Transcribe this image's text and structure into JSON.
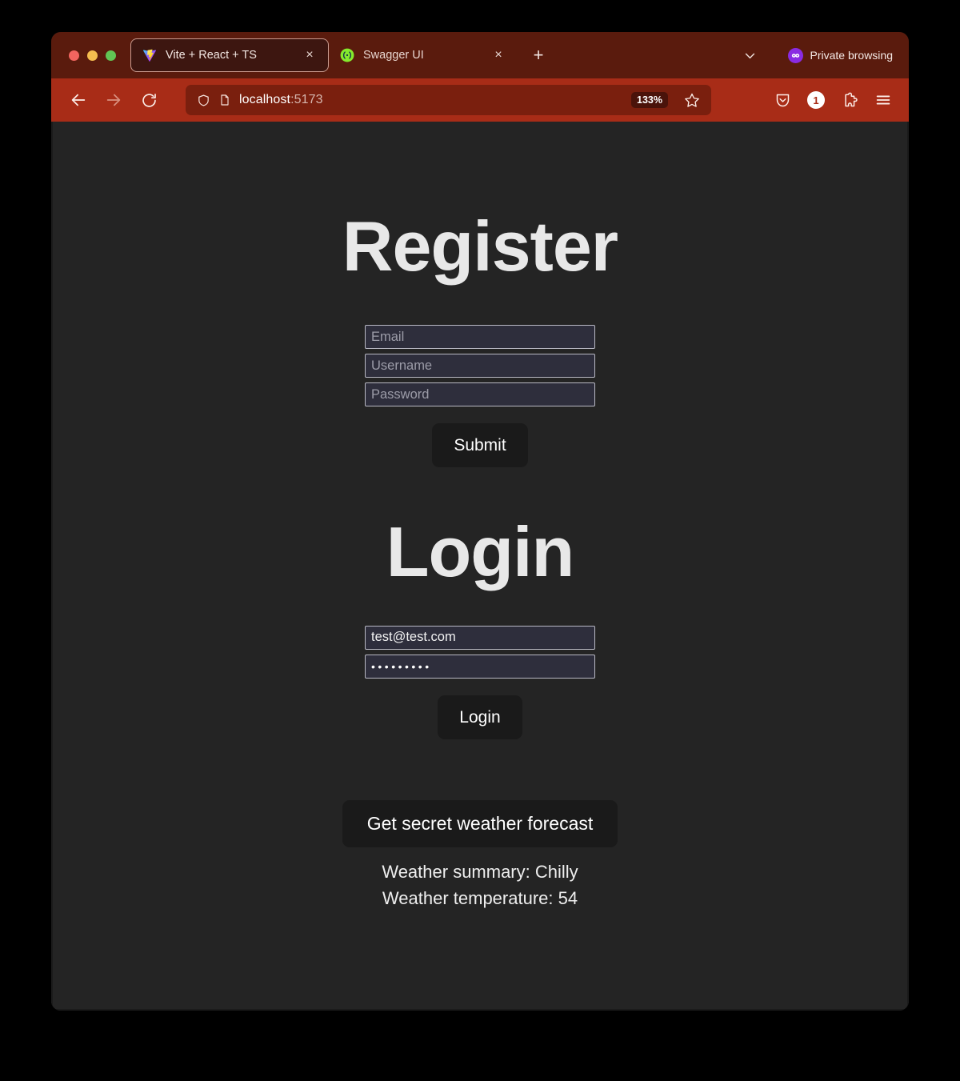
{
  "browser": {
    "window_controls": [
      "close",
      "minimize",
      "maximize"
    ],
    "tabs": [
      {
        "title": "Vite + React + TS",
        "favicon": "vite-icon",
        "active": true,
        "close_label": "×"
      },
      {
        "title": "Swagger UI",
        "favicon": "swagger-icon",
        "active": false,
        "close_label": "×"
      }
    ],
    "new_tab_label": "+",
    "list_all_tabs_icon": "chevron-down-icon",
    "private_browsing_label": "Private browsing",
    "private_browsing_icon": "mask-icon",
    "nav": {
      "back_icon": "arrow-left-icon",
      "forward_icon": "arrow-right-icon",
      "reload_icon": "reload-icon",
      "shield_icon": "shield-icon",
      "page_icon": "page-icon",
      "url_host": "localhost",
      "url_port": ":5173",
      "zoom_level": "133%",
      "bookmark_icon": "star-icon",
      "pocket_icon": "pocket-icon",
      "notification_count": "1",
      "extensions_icon": "puzzle-icon",
      "menu_icon": "hamburger-menu-icon"
    },
    "colors": {
      "tabbar_bg": "#5a1b0d",
      "navbar_bg": "#a82c17",
      "active_tab_bg": "#3d1610",
      "urlbar_bg": "#7a1f0e",
      "private_accent": "#8a2be2"
    }
  },
  "page": {
    "register": {
      "heading": "Register",
      "email_placeholder": "Email",
      "email_value": "",
      "username_placeholder": "Username",
      "username_value": "",
      "password_placeholder": "Password",
      "password_value": "",
      "submit_label": "Submit"
    },
    "login": {
      "heading": "Login",
      "email_placeholder": "",
      "email_value": "test@test.com",
      "password_placeholder": "",
      "password_value": "•••••••••",
      "login_label": "Login"
    },
    "weather": {
      "button_label": "Get secret weather forecast",
      "summary_line": "Weather summary: Chilly",
      "temperature_line": "Weather temperature: 54"
    },
    "colors": {
      "background": "#242424",
      "heading_text": "#e8e8e8",
      "button_bg": "#1a1a1a",
      "input_bg": "#2e2e3c"
    }
  }
}
